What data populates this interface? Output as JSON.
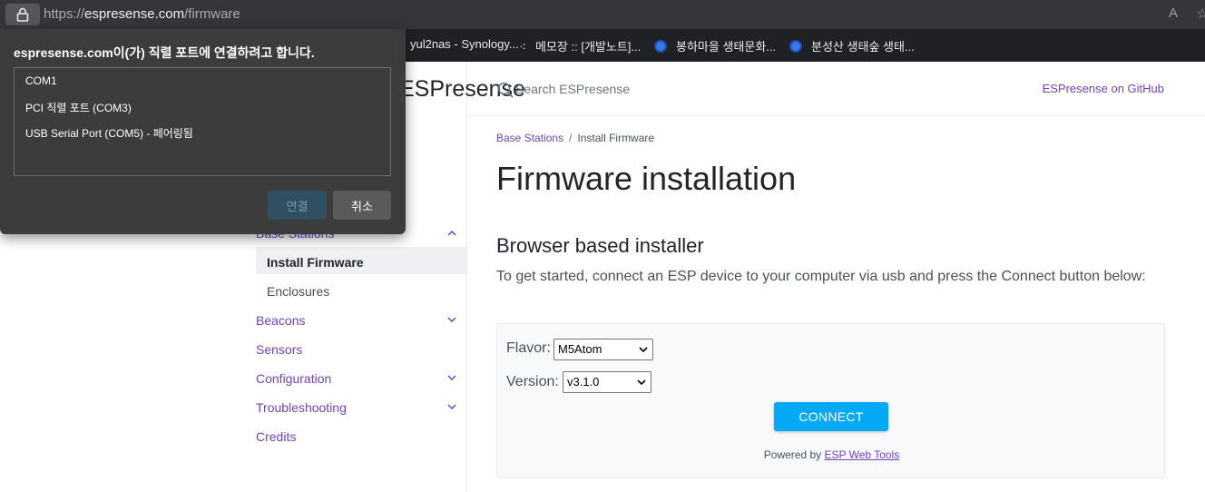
{
  "browser": {
    "url_scheme": "https://",
    "url_host": "espresense.com",
    "url_path": "/firmware",
    "read_aloud_glyph": "A",
    "favorite_glyph": "☆",
    "bookmarks": [
      {
        "label": "yul2nas - Synology...",
        "icon": "synology-icon"
      },
      {
        "label": "메모장 :: [개발노트]...",
        "icon": "dots-icon"
      },
      {
        "label": "봉하마을 생태문화...",
        "icon": "globe-icon"
      },
      {
        "label": "분성산 생태숲 생태...",
        "icon": "globe-icon"
      }
    ]
  },
  "dialog": {
    "title": "espresense.com이(가) 직렬 포트에 연결하려고 합니다.",
    "ports": [
      "COM1",
      "PCI 직렬 포트 (COM3)",
      "USB Serial Port (COM5) - 페어링됨"
    ],
    "connect_label": "연결",
    "cancel_label": "취소"
  },
  "sidebar": {
    "brand": "ESPresense",
    "items": [
      {
        "label": "Base Stations",
        "expanded": true
      },
      {
        "label": "Install Firmware",
        "active": true
      },
      {
        "label": "Enclosures"
      },
      {
        "label": "Beacons"
      },
      {
        "label": "Sensors"
      },
      {
        "label": "Configuration"
      },
      {
        "label": "Troubleshooting"
      },
      {
        "label": "Credits"
      }
    ]
  },
  "topbar": {
    "search_placeholder": "Search ESPresense",
    "github_link": "ESPresense on GitHub"
  },
  "main": {
    "breadcrumb": [
      "Base Stations",
      "Install Firmware"
    ],
    "title": "Firmware installation",
    "subtitle": "Browser based installer",
    "intro": "To get started, connect an ESP device to your computer via usb and press the Connect button below:",
    "flavor_label": "Flavor:",
    "flavor_value": "M5Atom",
    "version_label": "Version:",
    "version_value": "v3.1.0",
    "connect_label": "CONNECT",
    "powered_by": "Powered by",
    "powered_link": "ESP Web Tools"
  },
  "colors": {
    "accent": "#6f42c1",
    "connect_button": "#03a9f4",
    "dialog_bg": "#3c3c3c",
    "chrome_bg": "#35363a"
  }
}
